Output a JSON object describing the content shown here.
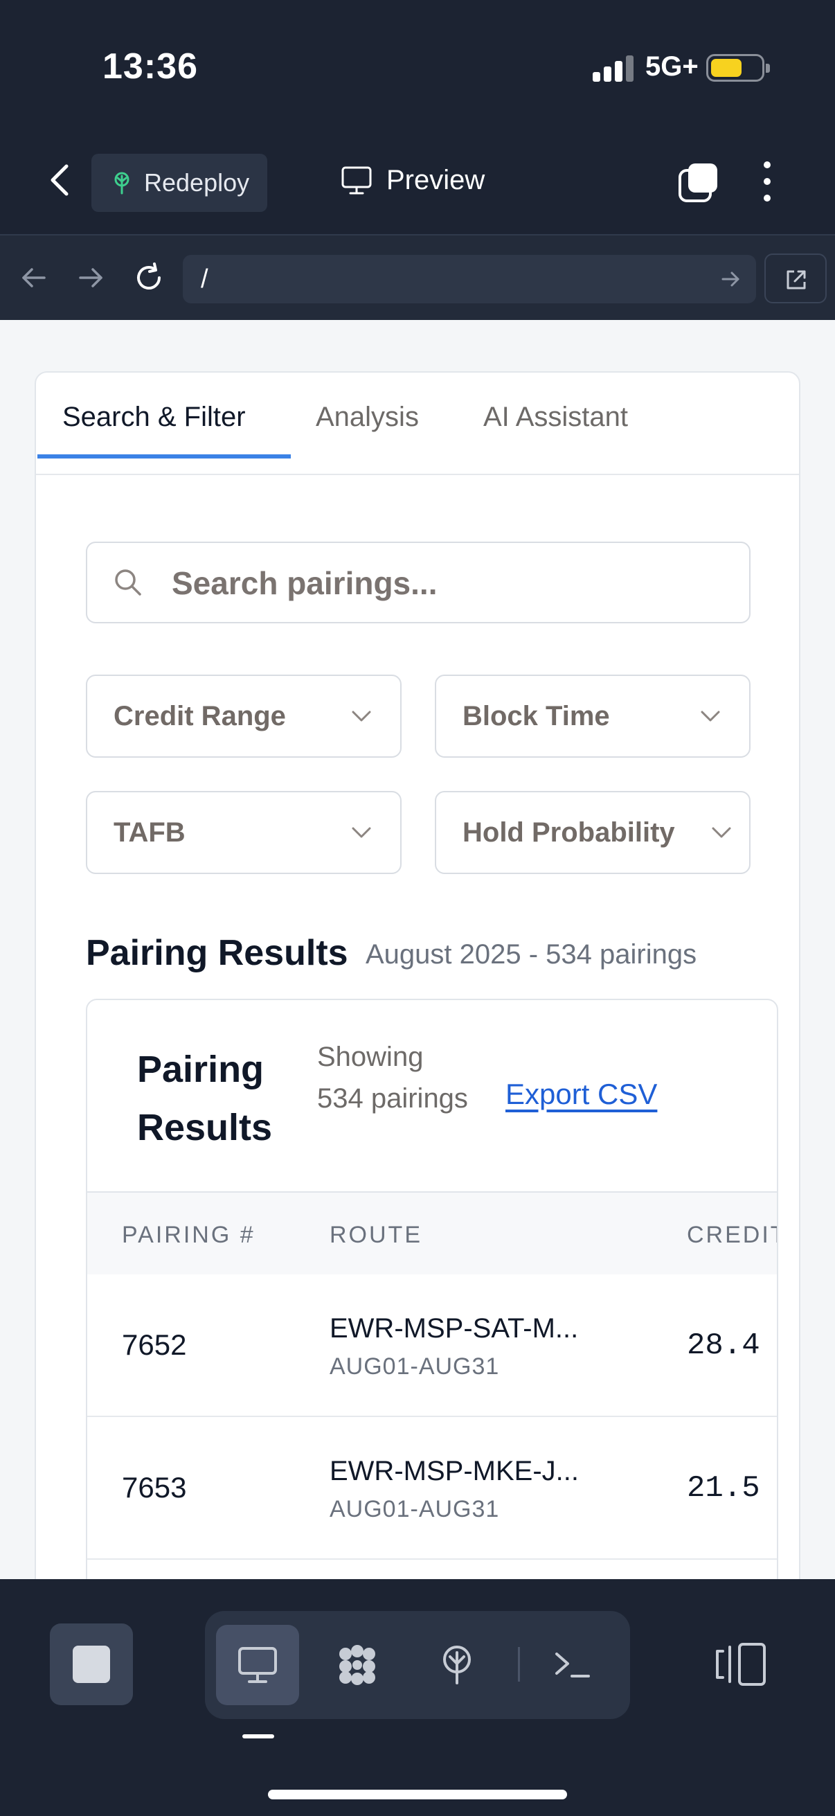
{
  "status": {
    "time": "13:36",
    "network": "5G+"
  },
  "toolbar": {
    "redeploy_label": "Redeploy",
    "preview_label": "Preview"
  },
  "browser": {
    "url": "/"
  },
  "tabs": [
    {
      "label": "Search & Filter",
      "active": true
    },
    {
      "label": "Analysis",
      "active": false
    },
    {
      "label": "AI Assistant",
      "active": false
    }
  ],
  "search": {
    "placeholder": "Search pairings..."
  },
  "filters": {
    "credit_range": "Credit Range",
    "block_time": "Block Time",
    "tafb": "TAFB",
    "hold_probability": "Hold Probability"
  },
  "results": {
    "heading": "Pairing Results",
    "subtitle": "August 2025 - 534 pairings",
    "card_title": "Pairing Results",
    "showing": "Showing 534 pairings",
    "export_label": "Export CSV",
    "columns": [
      "PAIRING #",
      "ROUTE",
      "CREDIT"
    ],
    "rows": [
      {
        "pairing": "7652",
        "route": "EWR-MSP-SAT-M...",
        "dates": "AUG01-AUG31",
        "credit": "28.4"
      },
      {
        "pairing": "7653",
        "route": "EWR-MSP-MKE-J...",
        "dates": "AUG01-AUG31",
        "credit": "21.5"
      }
    ]
  },
  "colors": {
    "accent": "#3b82e6",
    "link": "#1f5fd6",
    "chrome_bg": "#1c2332",
    "battery": "#f7d21f"
  }
}
